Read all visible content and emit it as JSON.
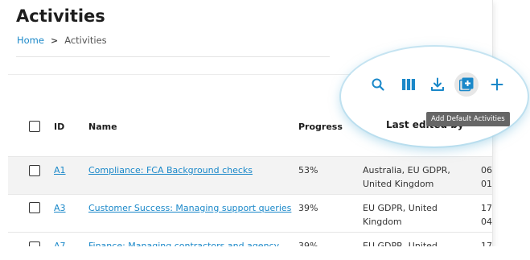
{
  "page": {
    "title": "Activities",
    "breadcrumb": {
      "home": "Home",
      "separator": ">",
      "current": "Activities"
    }
  },
  "toolbar": {
    "icons": [
      "search-icon",
      "columns-icon",
      "download-icon",
      "add-default-activities-icon",
      "plus-icon"
    ],
    "tooltip": "Add Default Activities",
    "accent_color": "#1a88c9"
  },
  "table": {
    "columns": {
      "id": "ID",
      "name": "Name",
      "progress": "Progress",
      "last_edited_by": "Last edited by"
    },
    "rows": [
      {
        "id": "A1",
        "name": "Compliance: FCA Background checks",
        "progress": "53%",
        "region_line1": "Australia, EU GDPR,",
        "region_line2": "United Kingdom",
        "date_line1": "06",
        "date_line2": "01"
      },
      {
        "id": "A3",
        "name": "Customer Success: Managing support queries",
        "progress": "39%",
        "region_line1": "EU GDPR, United",
        "region_line2": "Kingdom",
        "date_line1": "17",
        "date_line2": "04"
      },
      {
        "id": "A7",
        "name": "Finance: Managing contractors and agency",
        "progress": "39%",
        "region_line1": "EU GDPR, United",
        "region_line2": "",
        "date_line1": "17",
        "date_line2": ""
      }
    ]
  }
}
